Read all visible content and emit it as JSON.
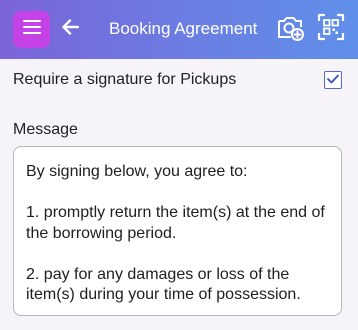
{
  "header": {
    "title": "Booking Agreement",
    "icons": [
      "menu-icon",
      "back-arrow-icon",
      "add-photo-icon",
      "qr-scan-icon"
    ],
    "colors": {
      "gradient_start": "#7b63d8",
      "gradient_end": "#5f8fe8",
      "menu_button": "#c543e6"
    }
  },
  "signature_option": {
    "label": "Require a signature for Pickups",
    "checked": true
  },
  "message": {
    "label": "Message",
    "paragraphs": [
      "By signing below, you agree to:",
      "1. promptly return the item(s) at the end of the borrowing period.",
      "2. pay for any damages or loss of the item(s) during your time of possession."
    ]
  }
}
